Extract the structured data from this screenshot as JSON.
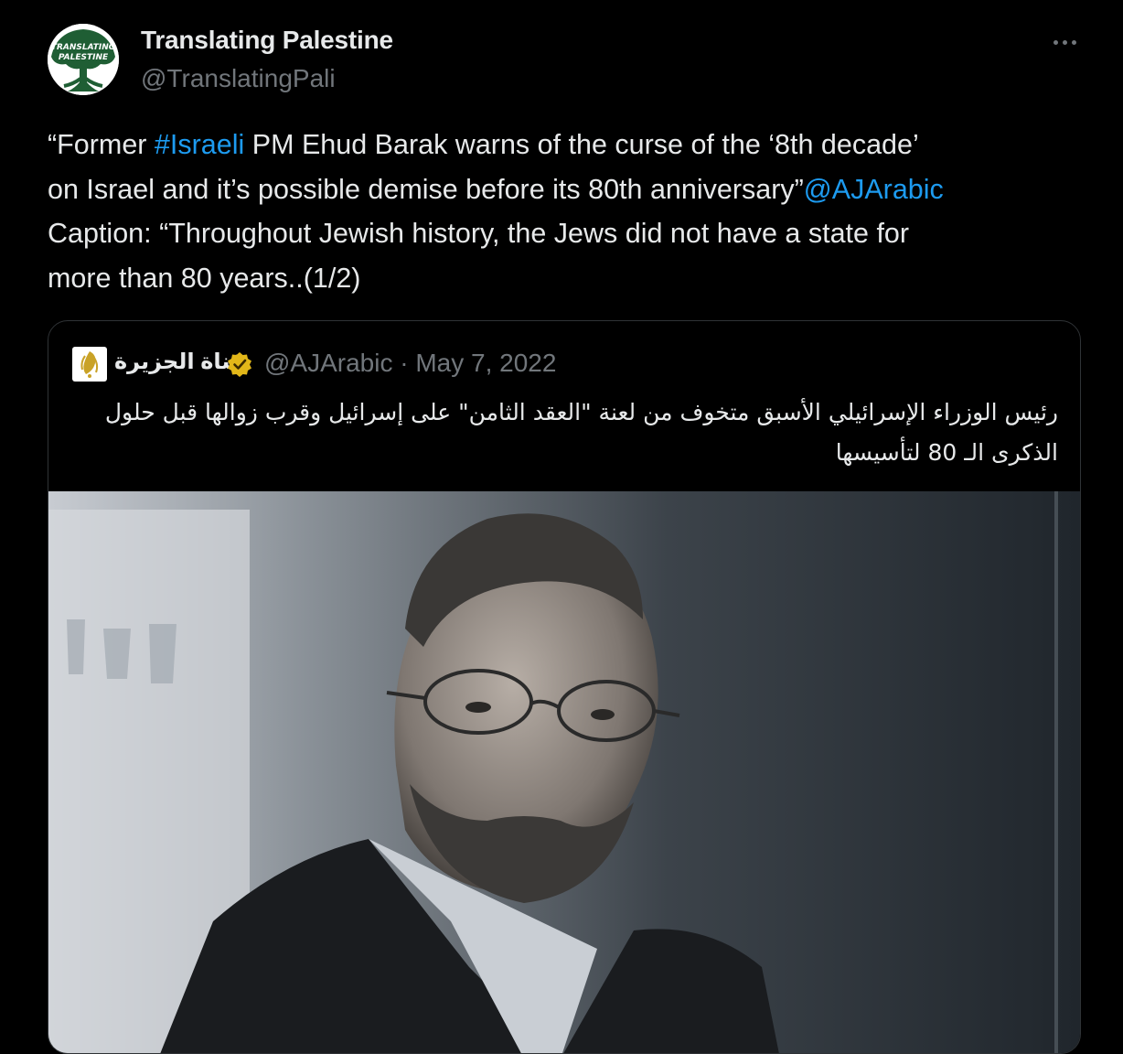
{
  "author": {
    "display_name": "Translating Palestine",
    "handle": "@TranslatingPali",
    "avatar_text_line1": "TRANSLATING",
    "avatar_text_line2": "PALESTINE"
  },
  "tweet": {
    "line1_before": "“Former ",
    "line1_hashtag": "#Israeli",
    "line1_after": " PM Ehud Barak warns of the curse of the ‘8th decade’",
    "line2_text": "on Israel and it’s possible demise before its 80th anniversary”",
    "line2_mention": "@AJArabic",
    "line3_text": "Caption: “Throughout Jewish history, the Jews did not have a state for",
    "line4_text": "more than 80 years..(1/2)"
  },
  "quoted": {
    "name": "قناة الجزيرة",
    "handle": "@AJArabic",
    "separator": " · ",
    "date": "May 7, 2022",
    "text": "رئيس الوزراء الإسرائيلي الأسبق متخوف من لعنة \"العقد الثامن\" على إسرائيل وقرب زوالها قبل حلول الذكرى الـ 80 لتأسيسها"
  },
  "icons": {
    "more": "more-horizontal-icon",
    "verified": "gold-verified-badge-icon",
    "logo": "al-jazeera-logo-icon"
  },
  "colors": {
    "background": "#000000",
    "text": "#e7e9ea",
    "muted": "#71767b",
    "link": "#1d9bf0",
    "border": "#2f3336",
    "badge_gold": "#e2b719"
  }
}
